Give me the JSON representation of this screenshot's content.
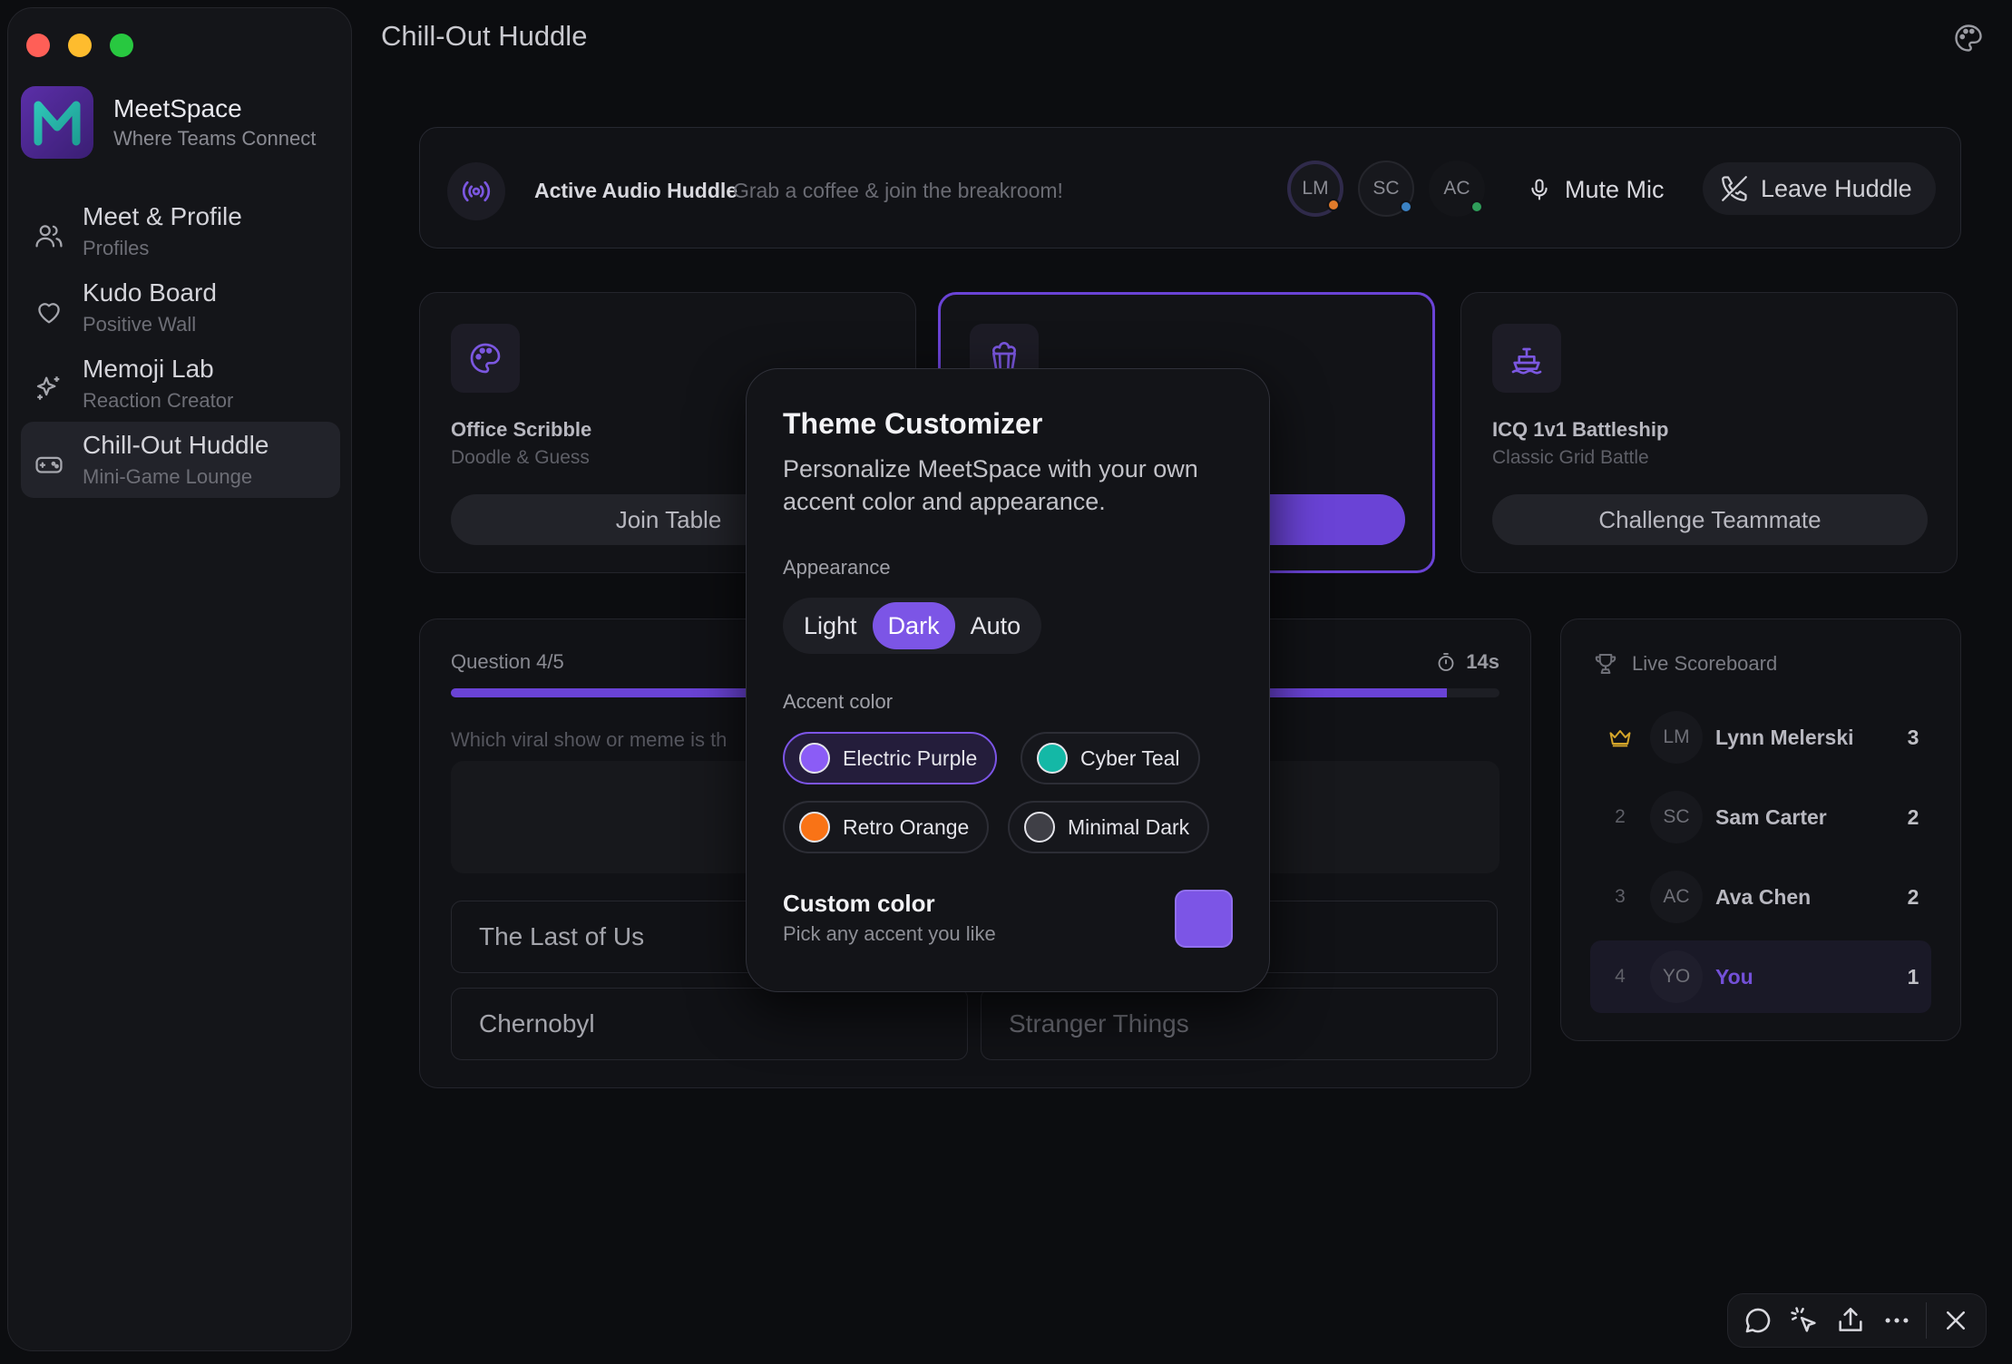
{
  "window": {
    "title": "Chill-Out Huddle"
  },
  "brand": {
    "name": "MeetSpace",
    "tagline": "Where Teams Connect",
    "logo_letter": "M"
  },
  "sidebar": {
    "items": [
      {
        "label": "Meet & Profile",
        "sub": "Profiles",
        "icon": "users-icon"
      },
      {
        "label": "Kudo Board",
        "sub": "Positive Wall",
        "icon": "heart-icon"
      },
      {
        "label": "Memoji Lab",
        "sub": "Reaction Creator",
        "icon": "sparkles-icon"
      },
      {
        "label": "Chill-Out Huddle",
        "sub": "Mini-Game Lounge",
        "icon": "gamepad-icon",
        "active": true
      }
    ]
  },
  "audio": {
    "title": "Active Audio Huddle",
    "subtitle": "Grab a coffee & join the breakroom!",
    "participants": [
      {
        "initials": "LM",
        "status_color": "#e07a2b"
      },
      {
        "initials": "SC",
        "status_color": "#3b82c4"
      },
      {
        "initials": "AC",
        "status_color": "#2f9e5a"
      }
    ],
    "mute_label": "Mute Mic",
    "leave_label": "Leave Huddle"
  },
  "games": [
    {
      "title": "Office Scribble",
      "sub": "Doodle & Guess",
      "button": "Join Table",
      "icon": "palette-icon"
    },
    {
      "title": "",
      "sub": "",
      "button": "",
      "icon": "popcorn-icon",
      "selected": true
    },
    {
      "title": "ICQ 1v1 Battleship",
      "sub": "Classic Grid Battle",
      "button": "Challenge Teammate",
      "icon": "ship-icon"
    }
  ],
  "quiz": {
    "question_label": "Question 4/5",
    "timer": "14s",
    "progress": 0.95,
    "prompt": "Which viral show or meme is th",
    "options": [
      "The Last of Us",
      "Chernobyl",
      "Stranger Things"
    ]
  },
  "scoreboard": {
    "title": "Live Scoreboard",
    "rows": [
      {
        "rank": "",
        "initials": "LM",
        "name": "Lynn Melerski",
        "score": "3",
        "crown": true
      },
      {
        "rank": "2",
        "initials": "SC",
        "name": "Sam Carter",
        "score": "2"
      },
      {
        "rank": "3",
        "initials": "AC",
        "name": "Ava Chen",
        "score": "2"
      },
      {
        "rank": "4",
        "initials": "YO",
        "name": "You",
        "score": "1",
        "me": true
      }
    ]
  },
  "theme_modal": {
    "title": "Theme Customizer",
    "description": "Personalize MeetSpace with your own accent color and appearance.",
    "appearance_label": "Appearance",
    "appearance_options": [
      "Light",
      "Dark",
      "Auto"
    ],
    "appearance_selected": "Dark",
    "accent_label": "Accent color",
    "accents": [
      {
        "name": "Electric Purple",
        "color": "#8b5cf6",
        "selected": true
      },
      {
        "name": "Cyber Teal",
        "color": "#14b8a6"
      },
      {
        "name": "Retro Orange",
        "color": "#f97316"
      },
      {
        "name": "Minimal Dark",
        "color": "#3f3f46"
      }
    ],
    "custom_title": "Custom color",
    "custom_sub": "Pick any accent you like",
    "custom_color": "#7c55e6"
  },
  "colors": {
    "accent": "#6a43d6",
    "background": "#0c0d10"
  }
}
